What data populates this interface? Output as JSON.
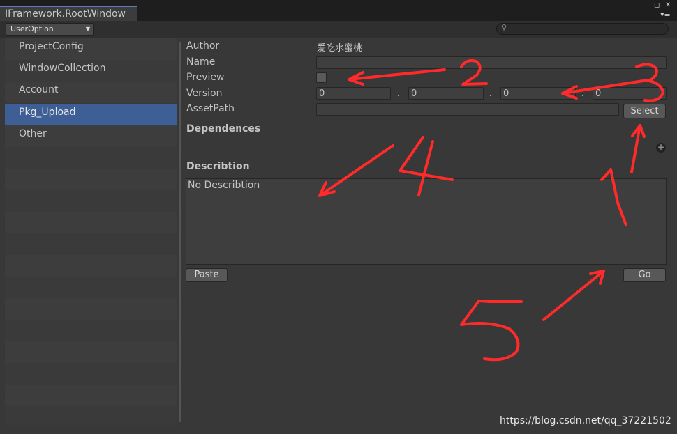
{
  "window": {
    "tab_title": "IFramework.RootWindow"
  },
  "toolbar": {
    "dropdown_value": "UserOption",
    "search_placeholder": ""
  },
  "sidebar": {
    "items": [
      {
        "label": "ProjectConfig"
      },
      {
        "label": "WindowCollection"
      },
      {
        "label": "Account"
      },
      {
        "label": "Pkg_Upload",
        "selected": true
      },
      {
        "label": "Other"
      }
    ]
  },
  "form": {
    "author_label": "Author",
    "author_value": "爱吃水蜜桃",
    "name_label": "Name",
    "name_value": "",
    "preview_label": "Preview",
    "preview_checked": false,
    "version_label": "Version",
    "version": [
      "0",
      "0",
      "0",
      "0"
    ],
    "version_separator": ".",
    "assetpath_label": "AssetPath",
    "assetpath_value": "",
    "select_button": "Select",
    "dependences_heading": "Dependences",
    "description_heading": "Describtion",
    "description_value": "No Describtion",
    "paste_button": "Paste",
    "go_button": "Go"
  },
  "annotations": {
    "numbers": [
      "2",
      "3",
      "4",
      "1",
      "5"
    ],
    "color": "#ff2a2a"
  },
  "watermark": "https://blog.csdn.net/qq_37221502",
  "colors": {
    "selection": "#3e5f96",
    "tab_accent": "#5a7bbd",
    "background": "#383838"
  }
}
